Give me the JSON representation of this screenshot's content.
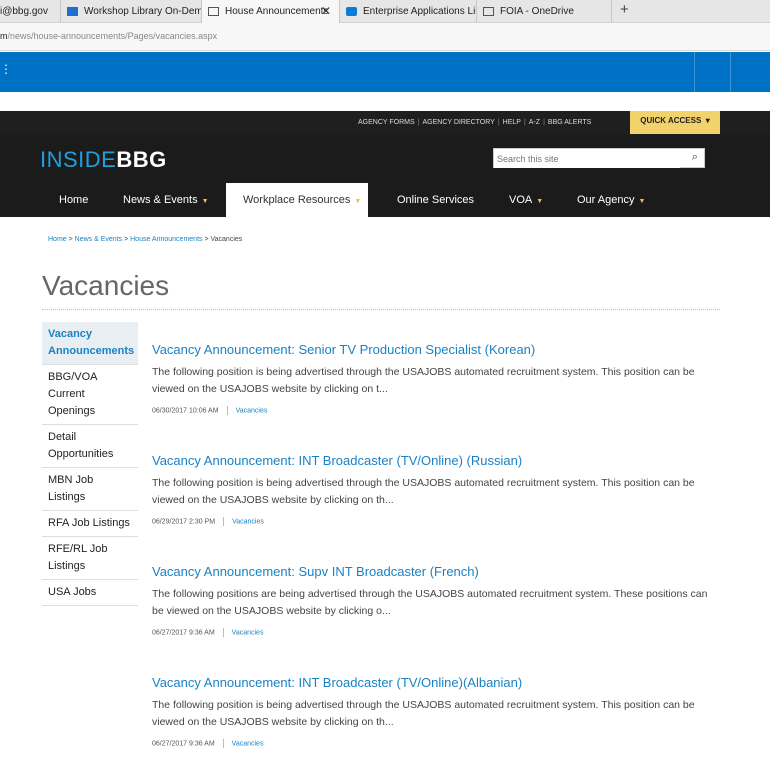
{
  "browser": {
    "tabs": [
      {
        "label": "i@bbg.gov",
        "icon": "mail-icon"
      },
      {
        "label": "Workshop Library On-Dema",
        "icon": "mail-icon"
      },
      {
        "label": "House Announcements",
        "icon": "page-icon",
        "active": true
      },
      {
        "label": "Enterprise Applications Limi",
        "icon": "sharepoint-icon"
      },
      {
        "label": "FOIA - OneDrive",
        "icon": "page-icon"
      }
    ],
    "close_glyph": "✕",
    "new_tab_glyph": "+",
    "url_prefix": "m",
    "url_path": "/news/house-announcements/Pages/vacancies.aspx"
  },
  "site": {
    "util_links": [
      "AGENCY FORMS",
      "AGENCY DIRECTORY",
      "HELP",
      "A-Z",
      "BBG ALERTS"
    ],
    "quick_access": "QUICK ACCESS",
    "logo_inside": "INSIDE",
    "logo_bbg": "BBG",
    "search_placeholder": "Search this site",
    "nav": [
      {
        "label": "Home",
        "caret": false
      },
      {
        "label": "News & Events",
        "caret": true
      },
      {
        "label": "Workplace Resources",
        "caret": true,
        "active": true
      },
      {
        "label": "Online Services",
        "caret": false
      },
      {
        "label": "VOA",
        "caret": true
      },
      {
        "label": "Our Agency",
        "caret": true
      }
    ]
  },
  "breadcrumb": {
    "items": [
      "Home",
      "News & Events",
      "House Announcements"
    ],
    "current": "Vacancies",
    "separator": " > "
  },
  "page": {
    "title": "Vacancies"
  },
  "leftnav": [
    {
      "label": "Vacancy Announcements",
      "active": true
    },
    {
      "label": "BBG/VOA Current Openings"
    },
    {
      "label": "Detail Opportunities"
    },
    {
      "label": "MBN Job Listings"
    },
    {
      "label": "RFA Job Listings"
    },
    {
      "label": "RFE/RL Job Listings"
    },
    {
      "label": "USA Jobs"
    }
  ],
  "articles": [
    {
      "title": "Vacancy Announcement: Senior TV Production Specialist (Korean)",
      "summary": "The following position is being advertised through the USAJOBS automated recruitment system.  This position can be viewed on the USAJOBS website by clicking on t...",
      "date": "06/30/2017 10:06 AM",
      "category": "Vacancies"
    },
    {
      "title": "Vacancy Announcement: INT Broadcaster (TV/Online) (Russian)",
      "summary": "The following position is being advertised through the USAJOBS automated recruitment system.  This position can be viewed on the USAJOBS website by clicking on th...",
      "date": "06/29/2017 2:30 PM",
      "category": "Vacancies"
    },
    {
      "title": "Vacancy Announcement: Supv INT Broadcaster (French)",
      "summary": "The following positions are being advertised through the USAJOBS automated recruitment system.  These positions can be viewed on the USAJOBS website by clicking o...",
      "date": "06/27/2017 9:36 AM",
      "category": "Vacancies"
    },
    {
      "title": "Vacancy Announcement: INT Broadcaster (TV/Online)(Albanian)",
      "summary": "The following position is being advertised through the USAJOBS automated recruitment system.  This position can be viewed on the USAJOBS website by clicking on th...",
      "date": "06/27/2017 9:36 AM",
      "category": "Vacancies"
    }
  ],
  "colors": {
    "suite_bar": "#0072c6",
    "header_bg": "#1b1b1b",
    "link": "#1a82c4",
    "quick_access_bg": "#f2d36b",
    "caret": "#f2c12e"
  }
}
